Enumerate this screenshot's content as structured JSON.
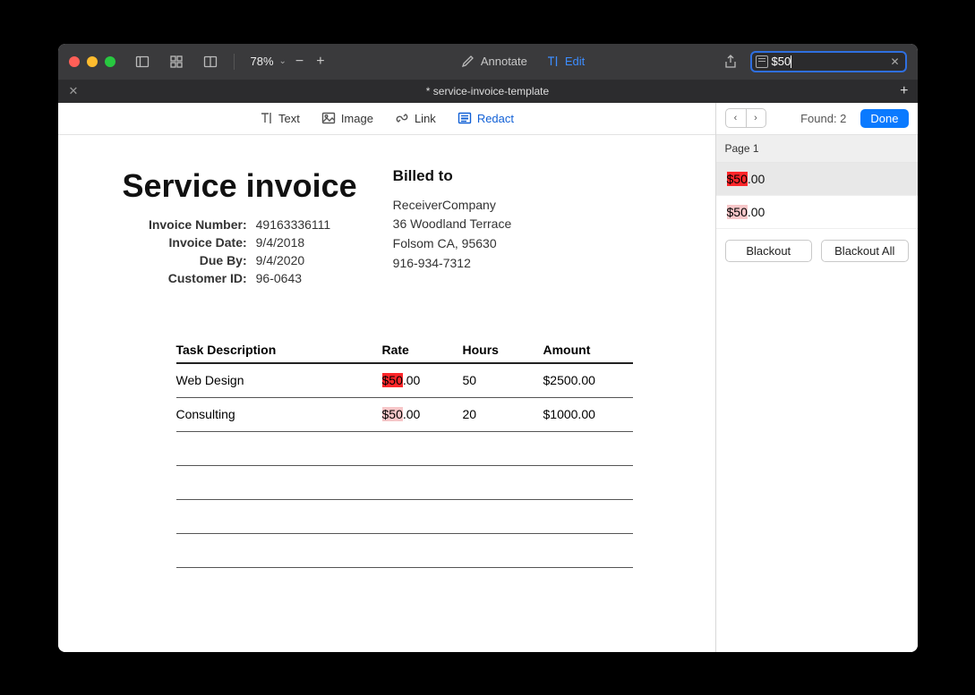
{
  "titlebar": {
    "zoom": "78%",
    "annotate_label": "Annotate",
    "edit_label": "Edit",
    "search_value": "$50"
  },
  "tab": {
    "title": "* service-invoice-template"
  },
  "edit_toolbar": {
    "text": "Text",
    "image": "Image",
    "link": "Link",
    "redact": "Redact"
  },
  "invoice": {
    "title": "Service invoice",
    "meta": {
      "number_label": "Invoice Number:",
      "number": "49163336111",
      "date_label": "Invoice Date:",
      "date": "9/4/2018",
      "due_label": "Due By:",
      "due": "9/4/2020",
      "customer_label": "Customer ID:",
      "customer": "96-0643"
    },
    "billed_to_label": "Billed to",
    "billed_to": {
      "company": "ReceiverCompany",
      "street": "36 Woodland Terrace",
      "city": "Folsom CA, 95630",
      "phone": "916-934-7312"
    },
    "columns": {
      "desc": "Task Description",
      "rate": "Rate",
      "hours": "Hours",
      "amount": "Amount"
    },
    "rows": [
      {
        "desc": "Web Design",
        "rate_hl": "$50",
        "rate_rest": ".00",
        "hours": "50",
        "amount": "$2500.00"
      },
      {
        "desc": "Consulting",
        "rate_hl": "$50",
        "rate_rest": ".00",
        "hours": "20",
        "amount": "$1000.00"
      }
    ]
  },
  "sidebar": {
    "found_label": "Found: 2",
    "done_label": "Done",
    "page_label": "Page 1",
    "results": [
      {
        "hl": "$50",
        "rest": ".00"
      },
      {
        "hl": "$50",
        "rest": ".00"
      }
    ],
    "blackout": "Blackout",
    "blackout_all": "Blackout All"
  }
}
